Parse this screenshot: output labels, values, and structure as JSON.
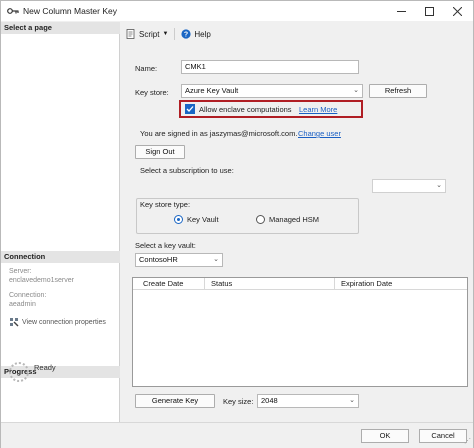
{
  "window": {
    "title": "New Column Master Key"
  },
  "left": {
    "select_page": "Select a page",
    "connection_head": "Connection",
    "server_label": "Server:",
    "server_value": "enclavedemo1server",
    "connection_label": "Connection:",
    "connection_value": "aeadmin",
    "view_props": "View connection properties",
    "progress_head": "Progress",
    "progress_status": "Ready"
  },
  "toolbar": {
    "script": "Script",
    "help": "Help"
  },
  "form": {
    "name_label": "Name:",
    "name_value": "CMK1",
    "keystore_label": "Key store:",
    "keystore_value": "Azure Key Vault",
    "refresh": "Refresh",
    "enclave_label": "Allow enclave computations",
    "enclave_checked": true,
    "learn_more": "Learn More",
    "signed_in": "You are signed in as jaszymas@microsoft.com.",
    "change_user": "Change user",
    "sign_out": "Sign Out",
    "subscription_label": "Select a subscription to use:",
    "subscription_value": "",
    "keystore_type_label": "Key store type:",
    "radio_keyvault": "Key Vault",
    "radio_hsm": "Managed HSM",
    "selected_type": "Key Vault",
    "vault_label": "Select a key vault:",
    "vault_value": "ContosoHR",
    "grid_columns": [
      "Create Date",
      "Status",
      "Expiration Date"
    ],
    "generate_key": "Generate Key",
    "keysize_label": "Key size:",
    "keysize_value": "2048"
  },
  "footer": {
    "ok": "OK",
    "cancel": "Cancel"
  },
  "colors": {
    "highlight_border": "#b01e24",
    "link": "#1a5fc4",
    "accent": "#1a66c4"
  }
}
